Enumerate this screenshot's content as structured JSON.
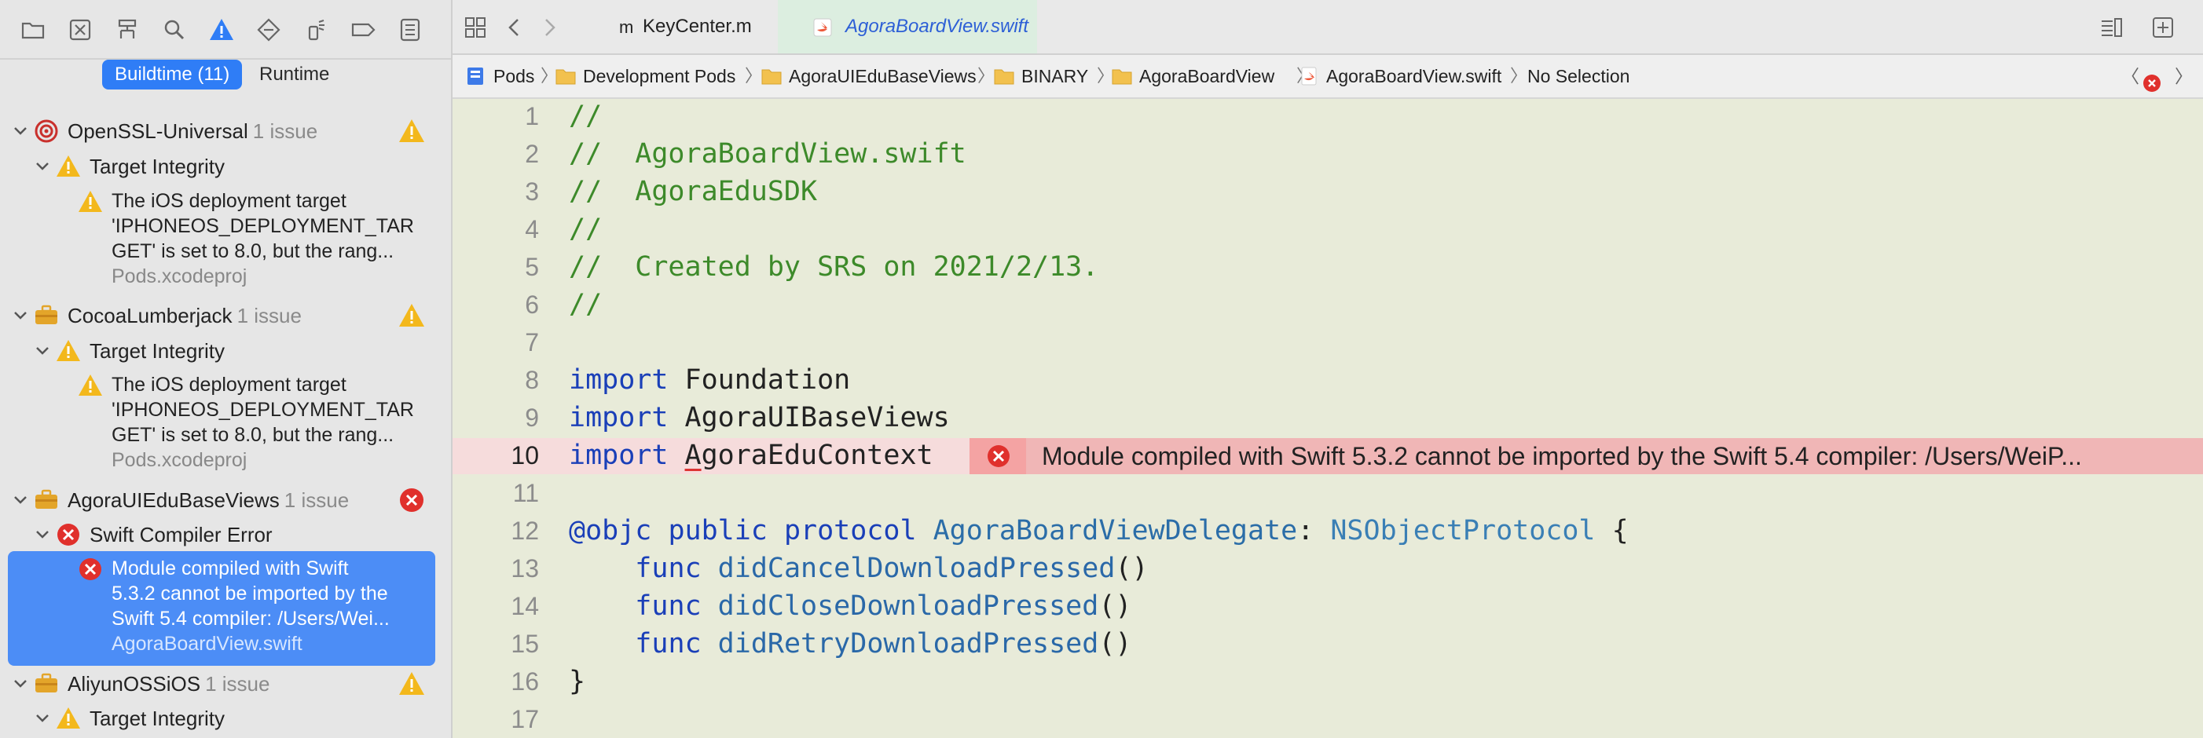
{
  "navigator": {
    "toolbar_icons": [
      "folder-icon",
      "x-square-icon",
      "hierarchy-icon",
      "search-icon",
      "warning-triangle-icon",
      "diamond-icon",
      "spray-icon",
      "tag-icon",
      "list-icon"
    ],
    "scope": {
      "buildtime": "Buildtime (11)",
      "runtime": "Runtime"
    },
    "groups": [
      {
        "name": "OpenSSL-Universal",
        "count": "1 issue",
        "icon": "target-icon",
        "badge": "warning",
        "child": "Target Integrity",
        "issue": {
          "lines": [
            "The iOS deployment target",
            "'IPHONEOS_DEPLOYMENT_TAR",
            "GET' is set to 8.0, but the rang..."
          ],
          "file": "Pods.xcodeproj"
        }
      },
      {
        "name": "CocoaLumberjack",
        "count": "1 issue",
        "icon": "briefcase-icon",
        "badge": "warning",
        "child": "Target Integrity",
        "issue": {
          "lines": [
            "The iOS deployment target",
            "'IPHONEOS_DEPLOYMENT_TAR",
            "GET' is set to 8.0, but the rang..."
          ],
          "file": "Pods.xcodeproj"
        }
      },
      {
        "name": "AgoraUIEduBaseViews",
        "count": "1 issue",
        "icon": "briefcase-icon",
        "badge": "error",
        "child": "Swift Compiler Error",
        "issue": {
          "lines": [
            "Module compiled with Swift",
            "5.3.2 cannot be imported by the",
            "Swift 5.4 compiler: /Users/Wei..."
          ],
          "file": "AgoraBoardView.swift"
        }
      },
      {
        "name": "AliyunOSSiOS",
        "count": "1 issue",
        "icon": "briefcase-icon",
        "badge": "warning",
        "child": "Target Integrity"
      }
    ]
  },
  "tabs": [
    {
      "icon": "m",
      "label": "KeyCenter.m"
    },
    {
      "icon": "swift",
      "label": "AgoraBoardView.swift"
    }
  ],
  "jumpbar": [
    "Pods",
    "Development Pods",
    "AgoraUIEduBaseViews",
    "BINARY",
    "AgoraBoardView",
    "AgoraBoardView.swift",
    "No Selection"
  ],
  "code": {
    "line_numbers": [
      "1",
      "2",
      "3",
      "4",
      "5",
      "6",
      "7",
      "8",
      "9",
      "10",
      "11",
      "12",
      "13",
      "14",
      "15",
      "16",
      "17"
    ],
    "comments": [
      "//",
      "//  AgoraBoardView.swift",
      "//  AgoraEduSDK",
      "//",
      "//  Created by SRS on 2021/2/13.",
      "//"
    ],
    "kw_import": "import",
    "imports": [
      "Foundation",
      "AgoraUIBaseViews"
    ],
    "error_import_first": "A",
    "error_import_rest": "goraEduContext",
    "kw_objc": "@objc",
    "kw_public": "public",
    "kw_protocol": "protocol",
    "protocol_name": "AgoraBoardViewDelegate",
    "colon": ":",
    "super_protocol": "NSObjectProtocol",
    "open_brace": "{",
    "close_brace": "}",
    "kw_func": "func",
    "funcs": [
      "didCancelDownloadPressed",
      "didCloseDownloadPressed",
      "didRetryDownloadPressed"
    ],
    "parens": "()",
    "error_message": "Module compiled with Swift 5.3.2 cannot be imported by the Swift 5.4 compiler: /Users/WeiP..."
  },
  "colors": {
    "accent": "#2f7df6",
    "error": "#e0302c",
    "warning": "#f3b81c",
    "editor_bg": "#e8ebd9"
  }
}
